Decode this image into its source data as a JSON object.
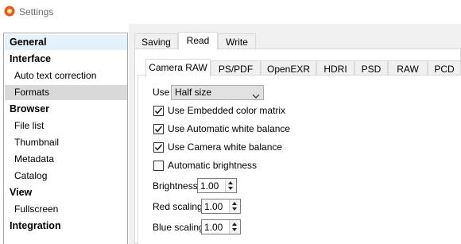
{
  "window": {
    "title": "Settings"
  },
  "sidebar": {
    "items": [
      {
        "label": "General",
        "type": "category",
        "state": "highlight"
      },
      {
        "label": "Interface",
        "type": "category"
      },
      {
        "label": "Auto text correction",
        "type": "sub"
      },
      {
        "label": "Formats",
        "type": "sub",
        "state": "selected"
      },
      {
        "label": "Browser",
        "type": "category"
      },
      {
        "label": "File list",
        "type": "sub"
      },
      {
        "label": "Thumbnail",
        "type": "sub"
      },
      {
        "label": "Metadata",
        "type": "sub"
      },
      {
        "label": "Catalog",
        "type": "sub"
      },
      {
        "label": "View",
        "type": "category"
      },
      {
        "label": "Fullscreen",
        "type": "sub"
      },
      {
        "label": "Integration",
        "type": "category"
      }
    ]
  },
  "tabs": [
    {
      "label": "Saving"
    },
    {
      "label": "Read",
      "active": true
    },
    {
      "label": "Write"
    }
  ],
  "subtabs": [
    {
      "label": "Camera RAW",
      "active": true
    },
    {
      "label": "PS/PDF"
    },
    {
      "label": "OpenEXR"
    },
    {
      "label": "HDRI"
    },
    {
      "label": "PSD"
    },
    {
      "label": "RAW"
    },
    {
      "label": "PCD"
    }
  ],
  "camera_raw": {
    "use_label": "Use",
    "use_value": "Half size",
    "checkboxes": [
      {
        "label": "Use Embedded color matrix",
        "checked": true
      },
      {
        "label": "Use Automatic white balance",
        "checked": true
      },
      {
        "label": "Use Camera white balance",
        "checked": true
      },
      {
        "label": "Automatic brightness",
        "checked": false
      }
    ],
    "brightness": {
      "label": "Brightness",
      "value": "1.00"
    },
    "red_scaling": {
      "label": "Red scaling",
      "value": "1.00"
    },
    "blue_scaling": {
      "label": "Blue scaling",
      "value": "1.00"
    }
  },
  "colors": {
    "sidebar_highlight": "#e5f1fb",
    "sidebar_selected": "#d9d9d9",
    "panel_background": "#f0f0f0",
    "app_icon": "#e8551c"
  }
}
